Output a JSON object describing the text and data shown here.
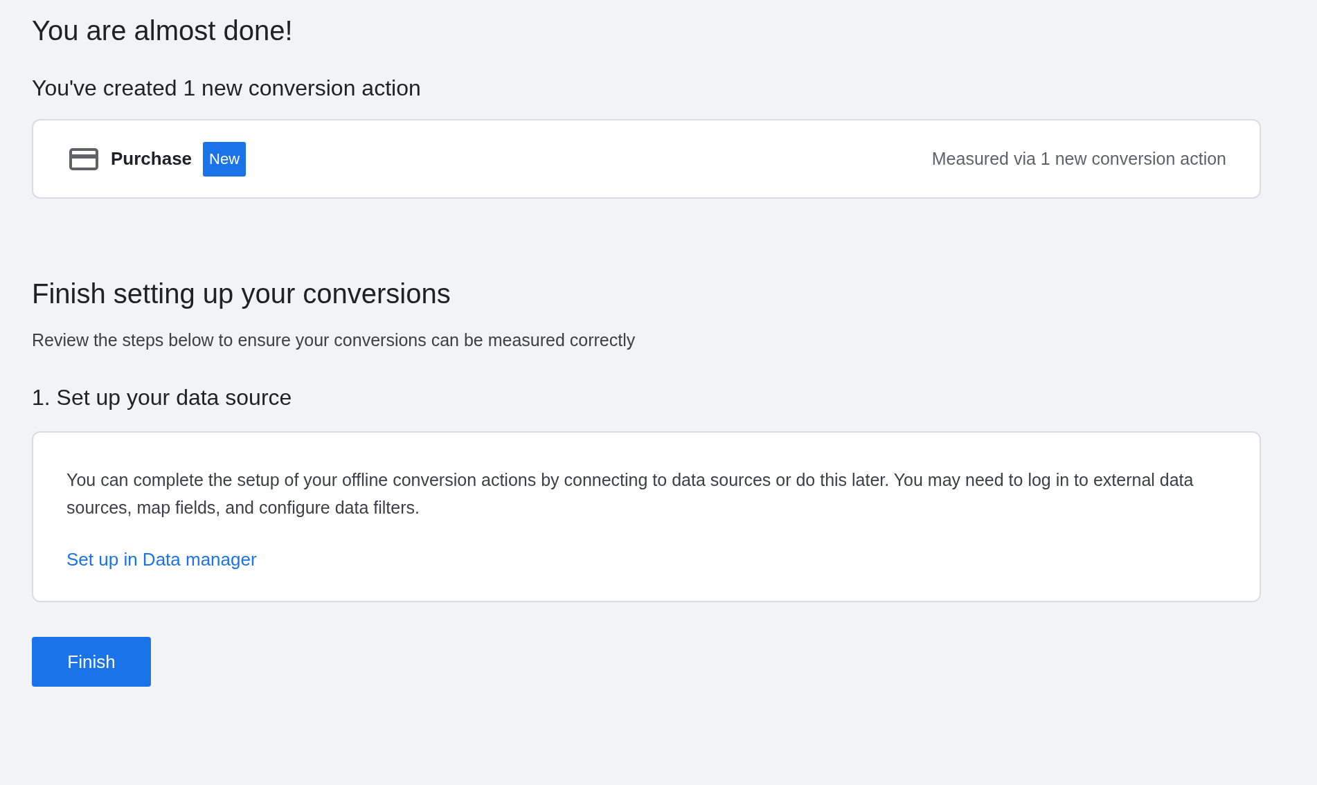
{
  "title": "You are almost done!",
  "created": {
    "heading": "You've created 1 new conversion action",
    "actions": [
      {
        "name": "Purchase",
        "badge": "New",
        "measured": "Measured via 1 new conversion action"
      }
    ]
  },
  "finish_setup": {
    "heading": "Finish setting up your conversions",
    "description": "Review the steps below to ensure your conversions can be measured correctly",
    "steps": [
      {
        "heading": "1. Set up your data source",
        "text": "You can complete the setup of your offline conversion actions by connecting to data sources or do this later. You may need to log in to external data sources, map fields, and configure data filters.",
        "link": "Set up in Data manager"
      }
    ]
  },
  "buttons": [
    {
      "label": "Finish"
    }
  ]
}
